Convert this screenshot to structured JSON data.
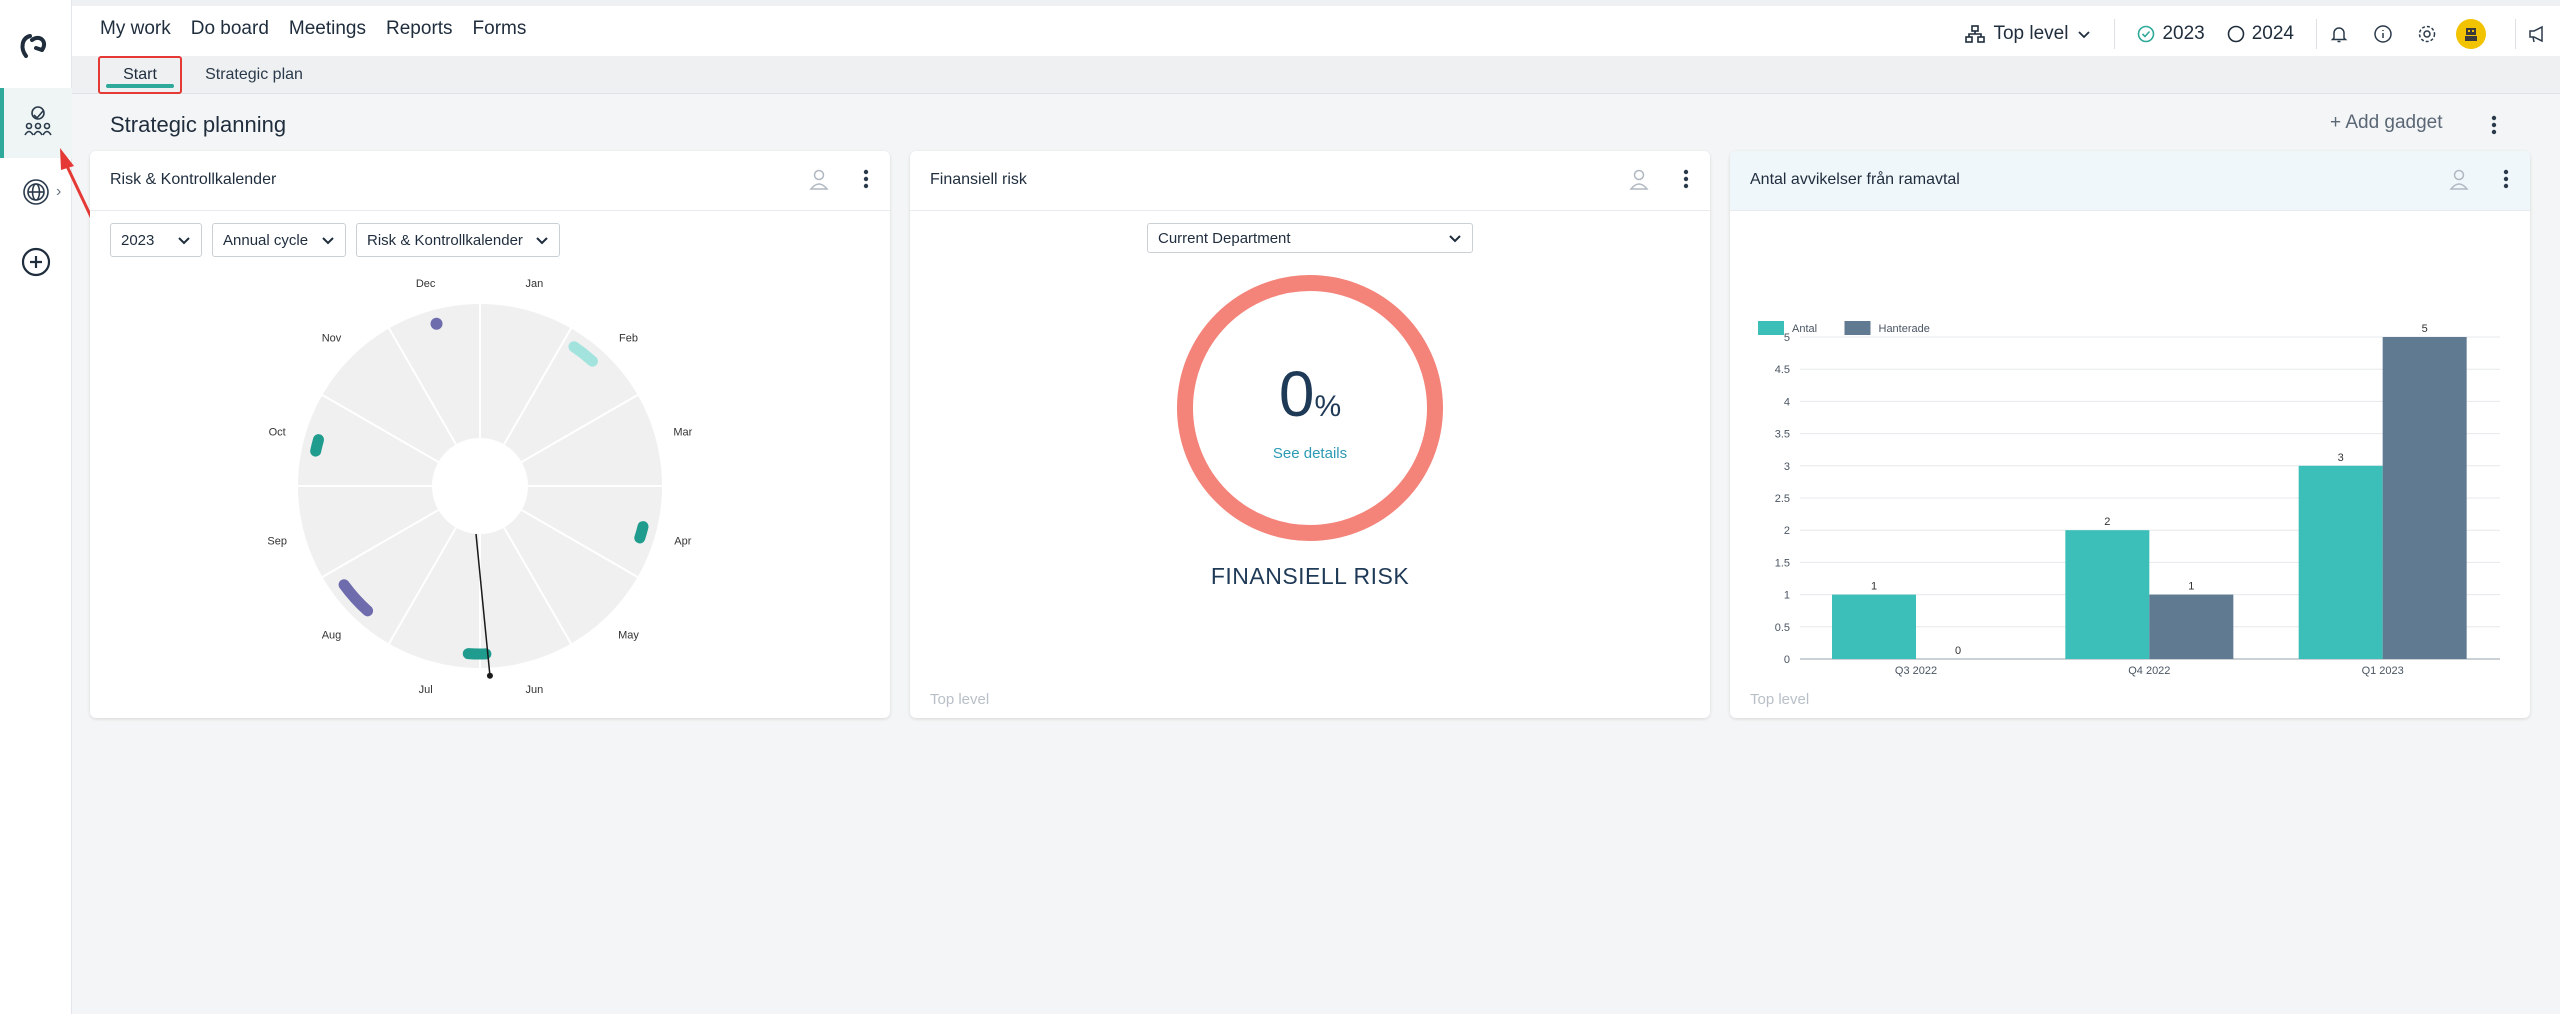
{
  "nav": {
    "items": [
      "My work",
      "Do board",
      "Meetings",
      "Reports",
      "Forms"
    ]
  },
  "toolbar": {
    "level_label": "Top level",
    "year_current": "2023",
    "year_next": "2024"
  },
  "tabs": [
    "Start",
    "Strategic plan"
  ],
  "page": {
    "title": "Strategic planning",
    "add_gadget": "+ Add gadget"
  },
  "gadget_risk_calendar": {
    "title": "Risk & Kontrollkalender",
    "filters": [
      "2023",
      "Annual cycle",
      "Risk & Kontrollkalender"
    ],
    "months": [
      "Jan",
      "Feb",
      "Mar",
      "Apr",
      "May",
      "Jun",
      "Jul",
      "Aug",
      "Sep",
      "Oct",
      "Nov",
      "Dec"
    ]
  },
  "gadget_financial_risk": {
    "title": "Finansiell risk",
    "department": "Current Department",
    "value": "0",
    "unit": "%",
    "details_link": "See details",
    "risk_name": "FINANSIELL RISK",
    "footer": "Top level"
  },
  "gadget_deviations": {
    "title": "Antal avvikelser från ramavtal",
    "footer": "Top level"
  },
  "chart_data": {
    "type": "bar",
    "categories": [
      "Q3 2022",
      "Q4 2022",
      "Q1 2023"
    ],
    "series": [
      {
        "name": "Antal",
        "values": [
          1,
          2,
          3
        ],
        "color": "#3bbfb8"
      },
      {
        "name": "Hanterade",
        "values": [
          0,
          1,
          5
        ],
        "color": "#5f7a91"
      }
    ],
    "ylim": [
      0,
      5
    ],
    "yticks": [
      "0",
      "0.5",
      "1",
      "1.5",
      "2",
      "2.5",
      "3",
      "3.5",
      "4",
      "4.5",
      "5"
    ],
    "legend": "top-left",
    "grid": true
  }
}
